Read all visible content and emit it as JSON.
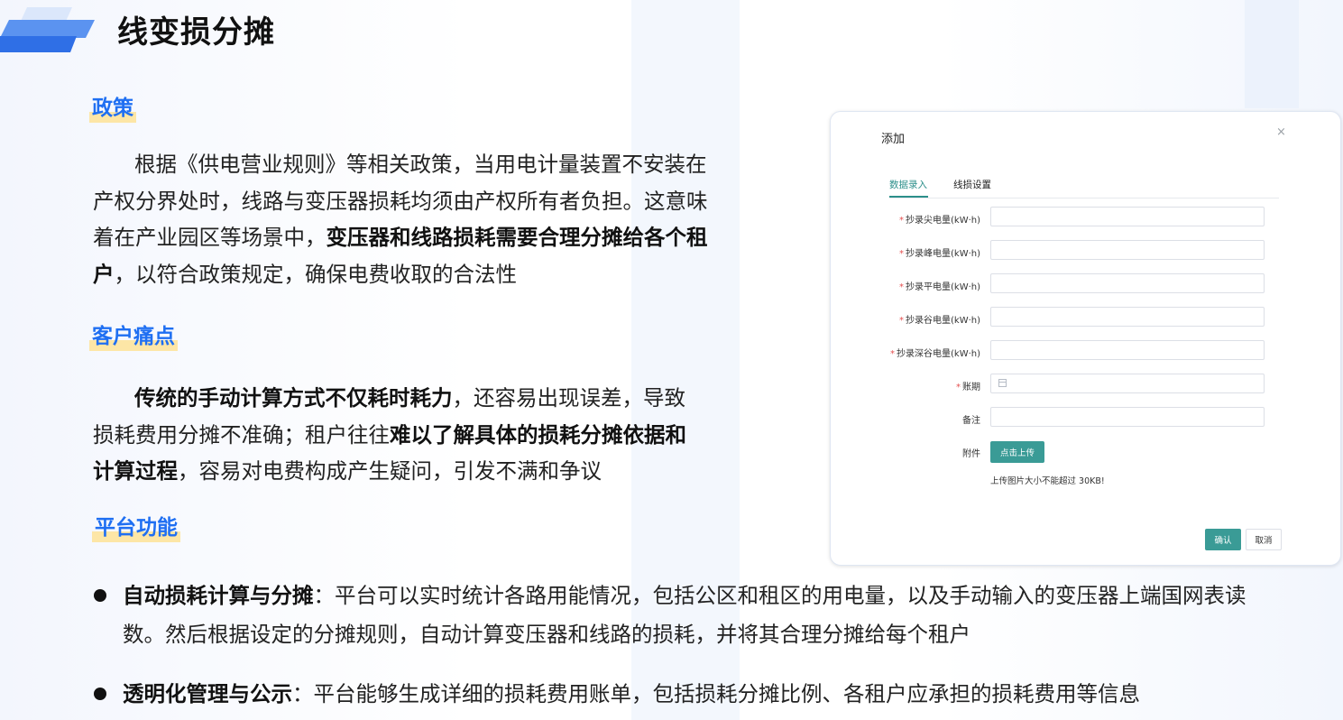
{
  "page": {
    "title": "线变损分摊"
  },
  "policy": {
    "tag": "政策",
    "p1": "根据《供电营业规则》等相关政策，当用电计量装置不安装在",
    "p2": "产权分界处时，线路与变压器损耗均须由产权所有者负担。这意味",
    "p3a": "着在产业园区等场景中，",
    "p3b": "变压器和线路损耗需要合理分摊给各个租",
    "p4a": "户",
    "p4b": "，以符合政策规定，确保电费收取的合法性"
  },
  "pain": {
    "tag": "客户痛点",
    "p1a": "传统的手动计算方式不仅耗时耗力",
    "p1b": "，还容易出现误差，导致",
    "p2a": "损耗费用分摊不准确；租户往往",
    "p2b": "难以了解具体的损耗分摊依据和",
    "p3a": "计算过程",
    "p3b": "，容易对电费构成产生疑问，引发不满和争议"
  },
  "platform": {
    "tag": "平台功能"
  },
  "bullets": [
    {
      "bold": "自动损耗计算与分摊",
      "text1": "：平台可以实时统计各路用能情况，包括公区和租区的用电量，以及手动输入的变压器上端国网表读",
      "text2": "数。然后根据设定的分摊规则，自动计算变压器和线路的损耗，并将其合理分摊给每个租户"
    },
    {
      "bold": "透明化管理与公示",
      "text1": "：平台能够生成详细的损耗费用账单，包括损耗分摊比例、各租户应承担的损耗费用等信息"
    }
  ],
  "dialog": {
    "title": "添加",
    "close": "×",
    "tabs": [
      "数据录入",
      "线损设置"
    ],
    "active_tab": "数据录入",
    "fields": [
      {
        "label": "抄录尖电量(kW·h)",
        "required": "*",
        "value": ""
      },
      {
        "label": "抄录峰电量(kW·h)",
        "required": "*",
        "value": ""
      },
      {
        "label": "抄录平电量(kW·h)",
        "required": "*",
        "value": ""
      },
      {
        "label": "抄录谷电量(kW·h)",
        "required": "*",
        "value": ""
      },
      {
        "label": "抄录深谷电量(kW·h)",
        "required": "*",
        "value": ""
      },
      {
        "label": "账期",
        "required": "*",
        "value": ""
      },
      {
        "label": "备注",
        "required": "",
        "value": ""
      }
    ],
    "attachment_label": "附件",
    "upload_button": "点击上传",
    "upload_tip": "上传图片大小不能超过 30KB!",
    "ok_button": "确认",
    "cancel_button": "取消"
  },
  "colors": {
    "accent": "#3a9b96",
    "tag_text": "#1f6ff2",
    "tag_highlight": "#fde6a6"
  }
}
